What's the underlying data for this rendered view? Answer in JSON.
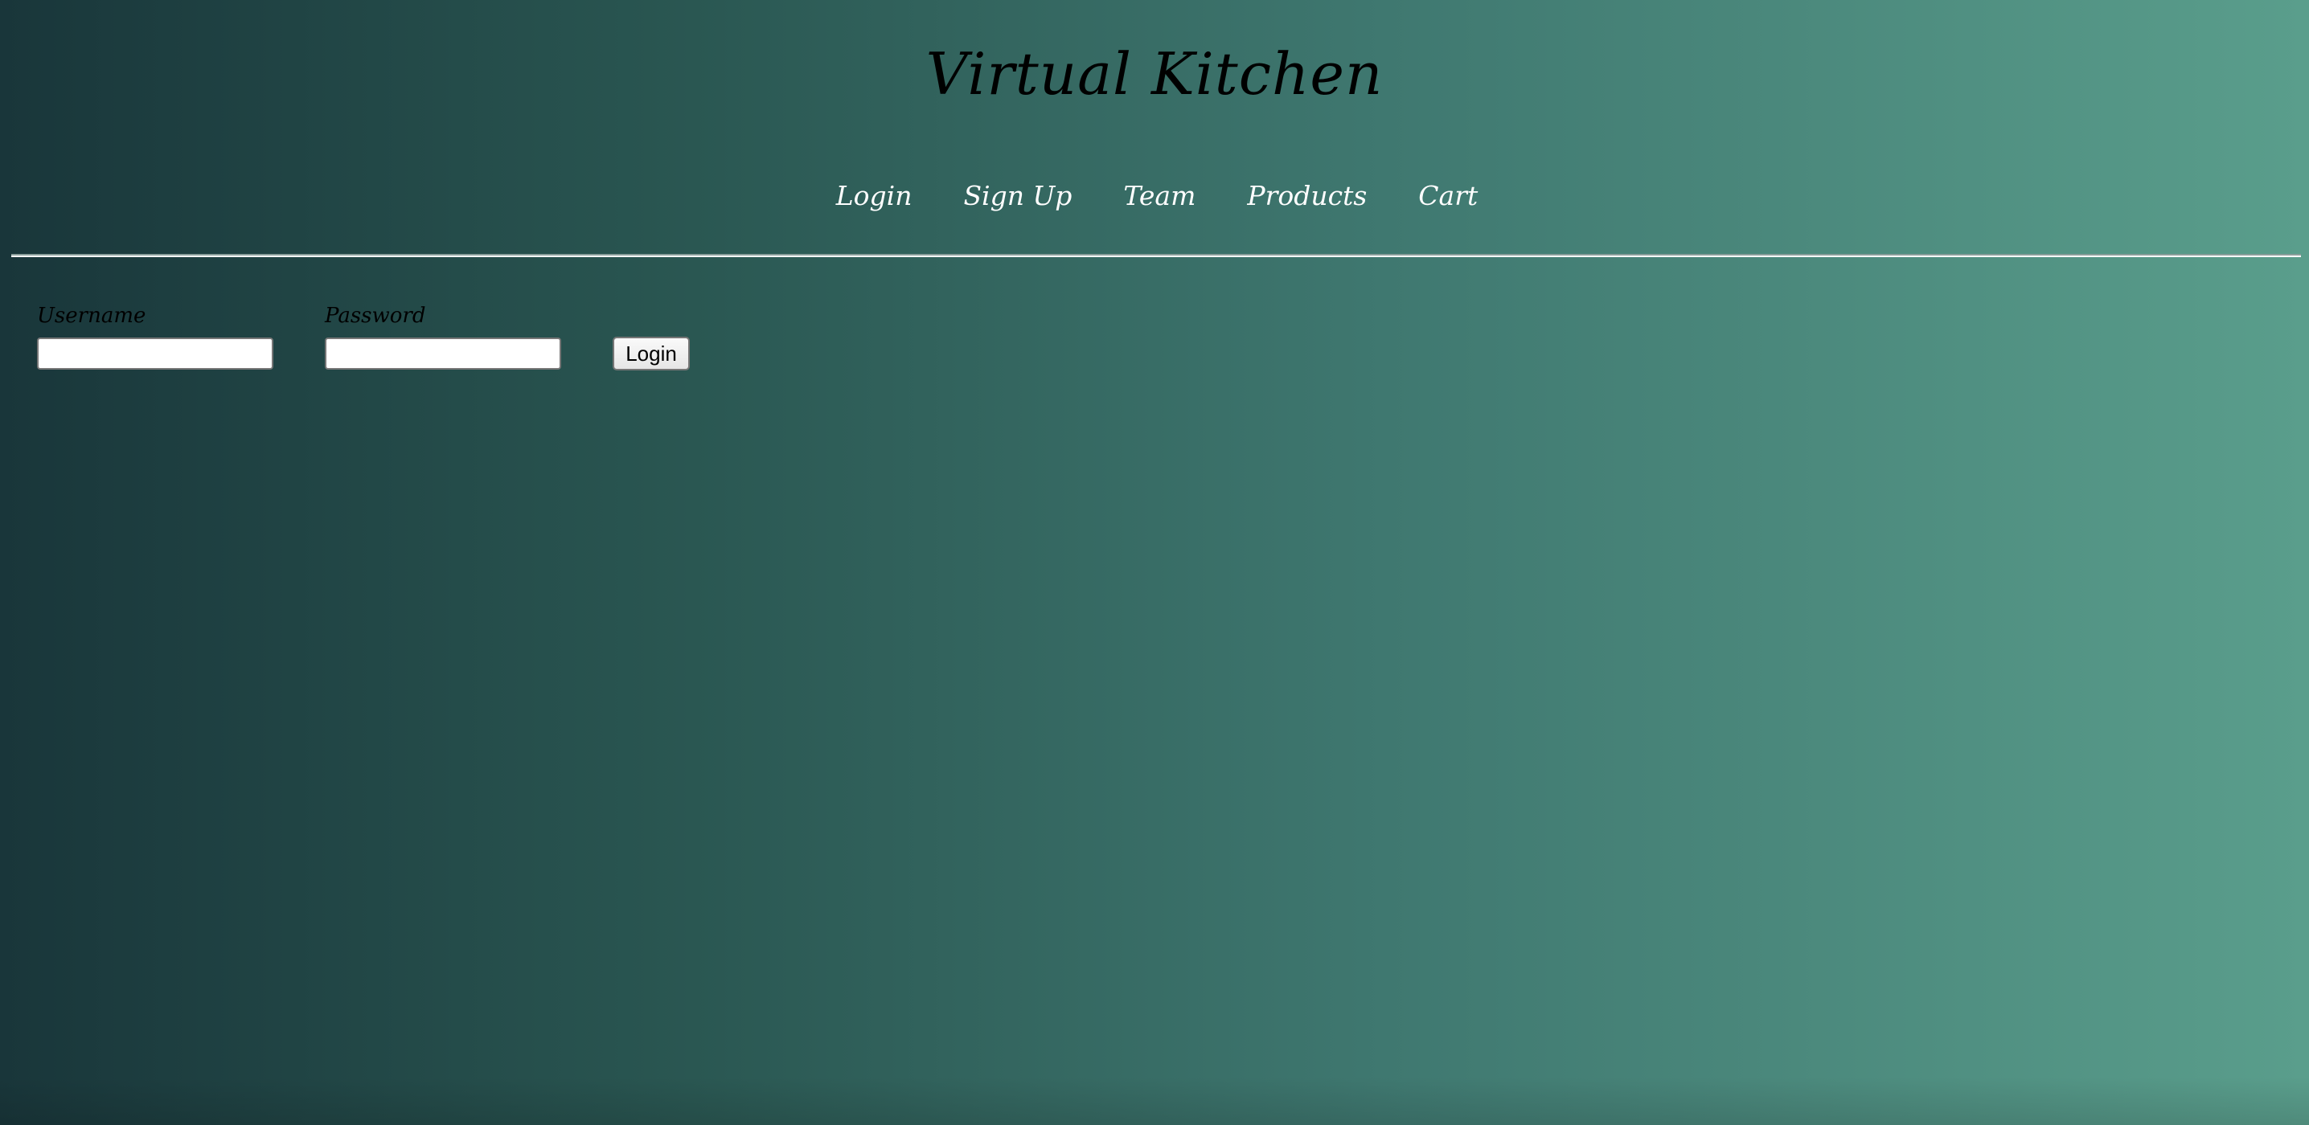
{
  "header": {
    "title": "Virtual Kitchen"
  },
  "nav": {
    "items": [
      {
        "label": "Login"
      },
      {
        "label": "Sign Up"
      },
      {
        "label": "Team"
      },
      {
        "label": "Products"
      },
      {
        "label": "Cart"
      }
    ]
  },
  "login_form": {
    "username_label": "Username",
    "username_value": "",
    "password_label": "Password",
    "password_value": "",
    "submit_label": "Login"
  },
  "colors": {
    "gradient_start": "#19363a",
    "gradient_end": "#5a9e8c",
    "nav_text": "#ffffff",
    "title_text": "#000000"
  }
}
